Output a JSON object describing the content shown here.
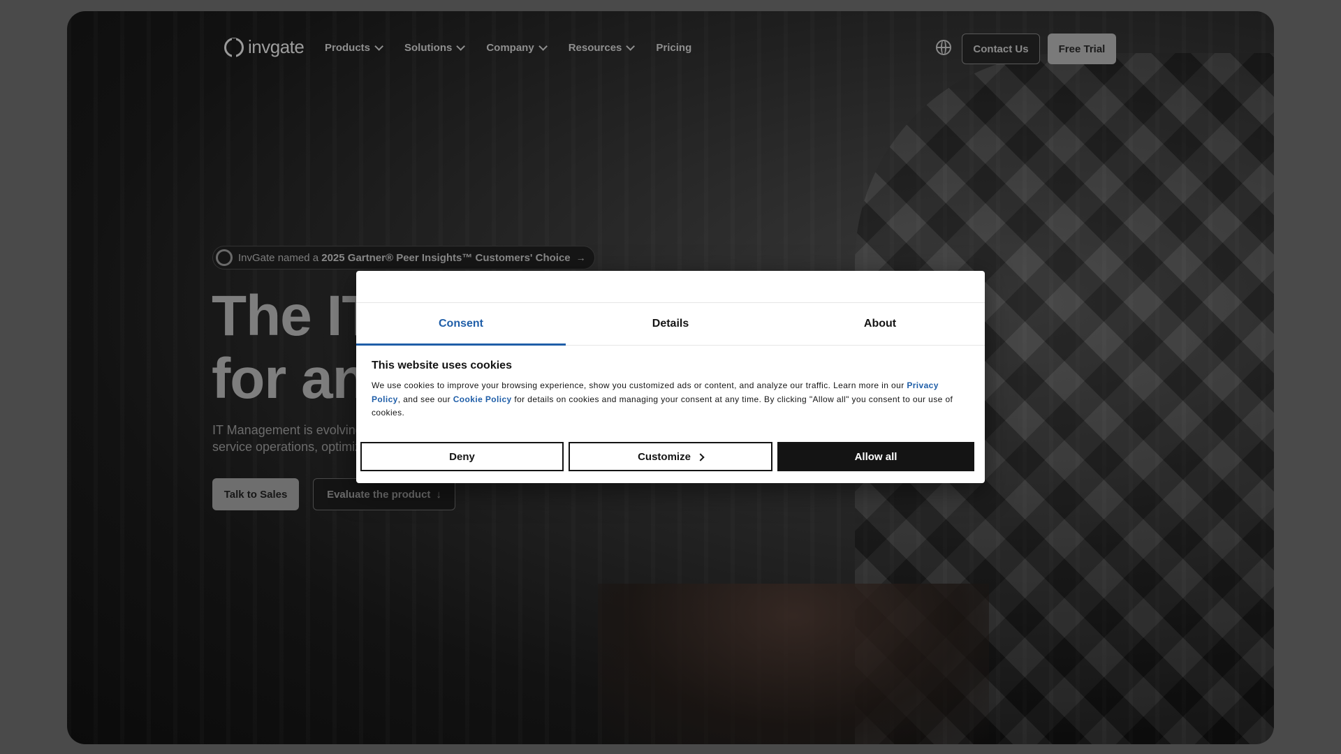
{
  "nav": {
    "logo_text": "invgate",
    "menu": [
      {
        "label": "Products",
        "dropdown": true
      },
      {
        "label": "Solutions",
        "dropdown": true
      },
      {
        "label": "Company",
        "dropdown": true
      },
      {
        "label": "Resources",
        "dropdown": true
      },
      {
        "label": "Pricing",
        "dropdown": false
      }
    ],
    "language_icon": "globe-icon",
    "contact_label": "Contact Us",
    "trial_label": "Free Trial"
  },
  "hero": {
    "badge_prefix": "InvGate named a ",
    "badge_bold": "2025 Gartner® Peer Insights™ Customers' Choice",
    "badge_arrow": "→",
    "headline_line1": "The IT",
    "headline_line2": "for an",
    "subtitle_line1": "IT Management is evolving",
    "subtitle_line2": "service operations, optimiz",
    "talk_to_sales": "Talk to Sales",
    "evaluate": "Evaluate the product",
    "evaluate_arrow": "↓"
  },
  "cookie_dialog": {
    "tabs": [
      {
        "label": "Consent",
        "active": true
      },
      {
        "label": "Details",
        "active": false
      },
      {
        "label": "About",
        "active": false
      }
    ],
    "title": "This website uses cookies",
    "text_1": "We use cookies to improve your browsing experience, show you customized ads or content, and analyze our traffic. Learn more in our ",
    "privacy_link": "Privacy Policy",
    "text_2": ", and see our ",
    "cookie_link": "Cookie Policy",
    "text_3": " for details on cookies and managing your consent at any time. By clicking \"Allow all\" you consent to our use of cookies.",
    "deny": "Deny",
    "customize": "Customize",
    "allow_all": "Allow all"
  },
  "colors": {
    "accent": "#1f5ea8",
    "overlay": "#4a4a4a",
    "primary_button": "#141414"
  }
}
